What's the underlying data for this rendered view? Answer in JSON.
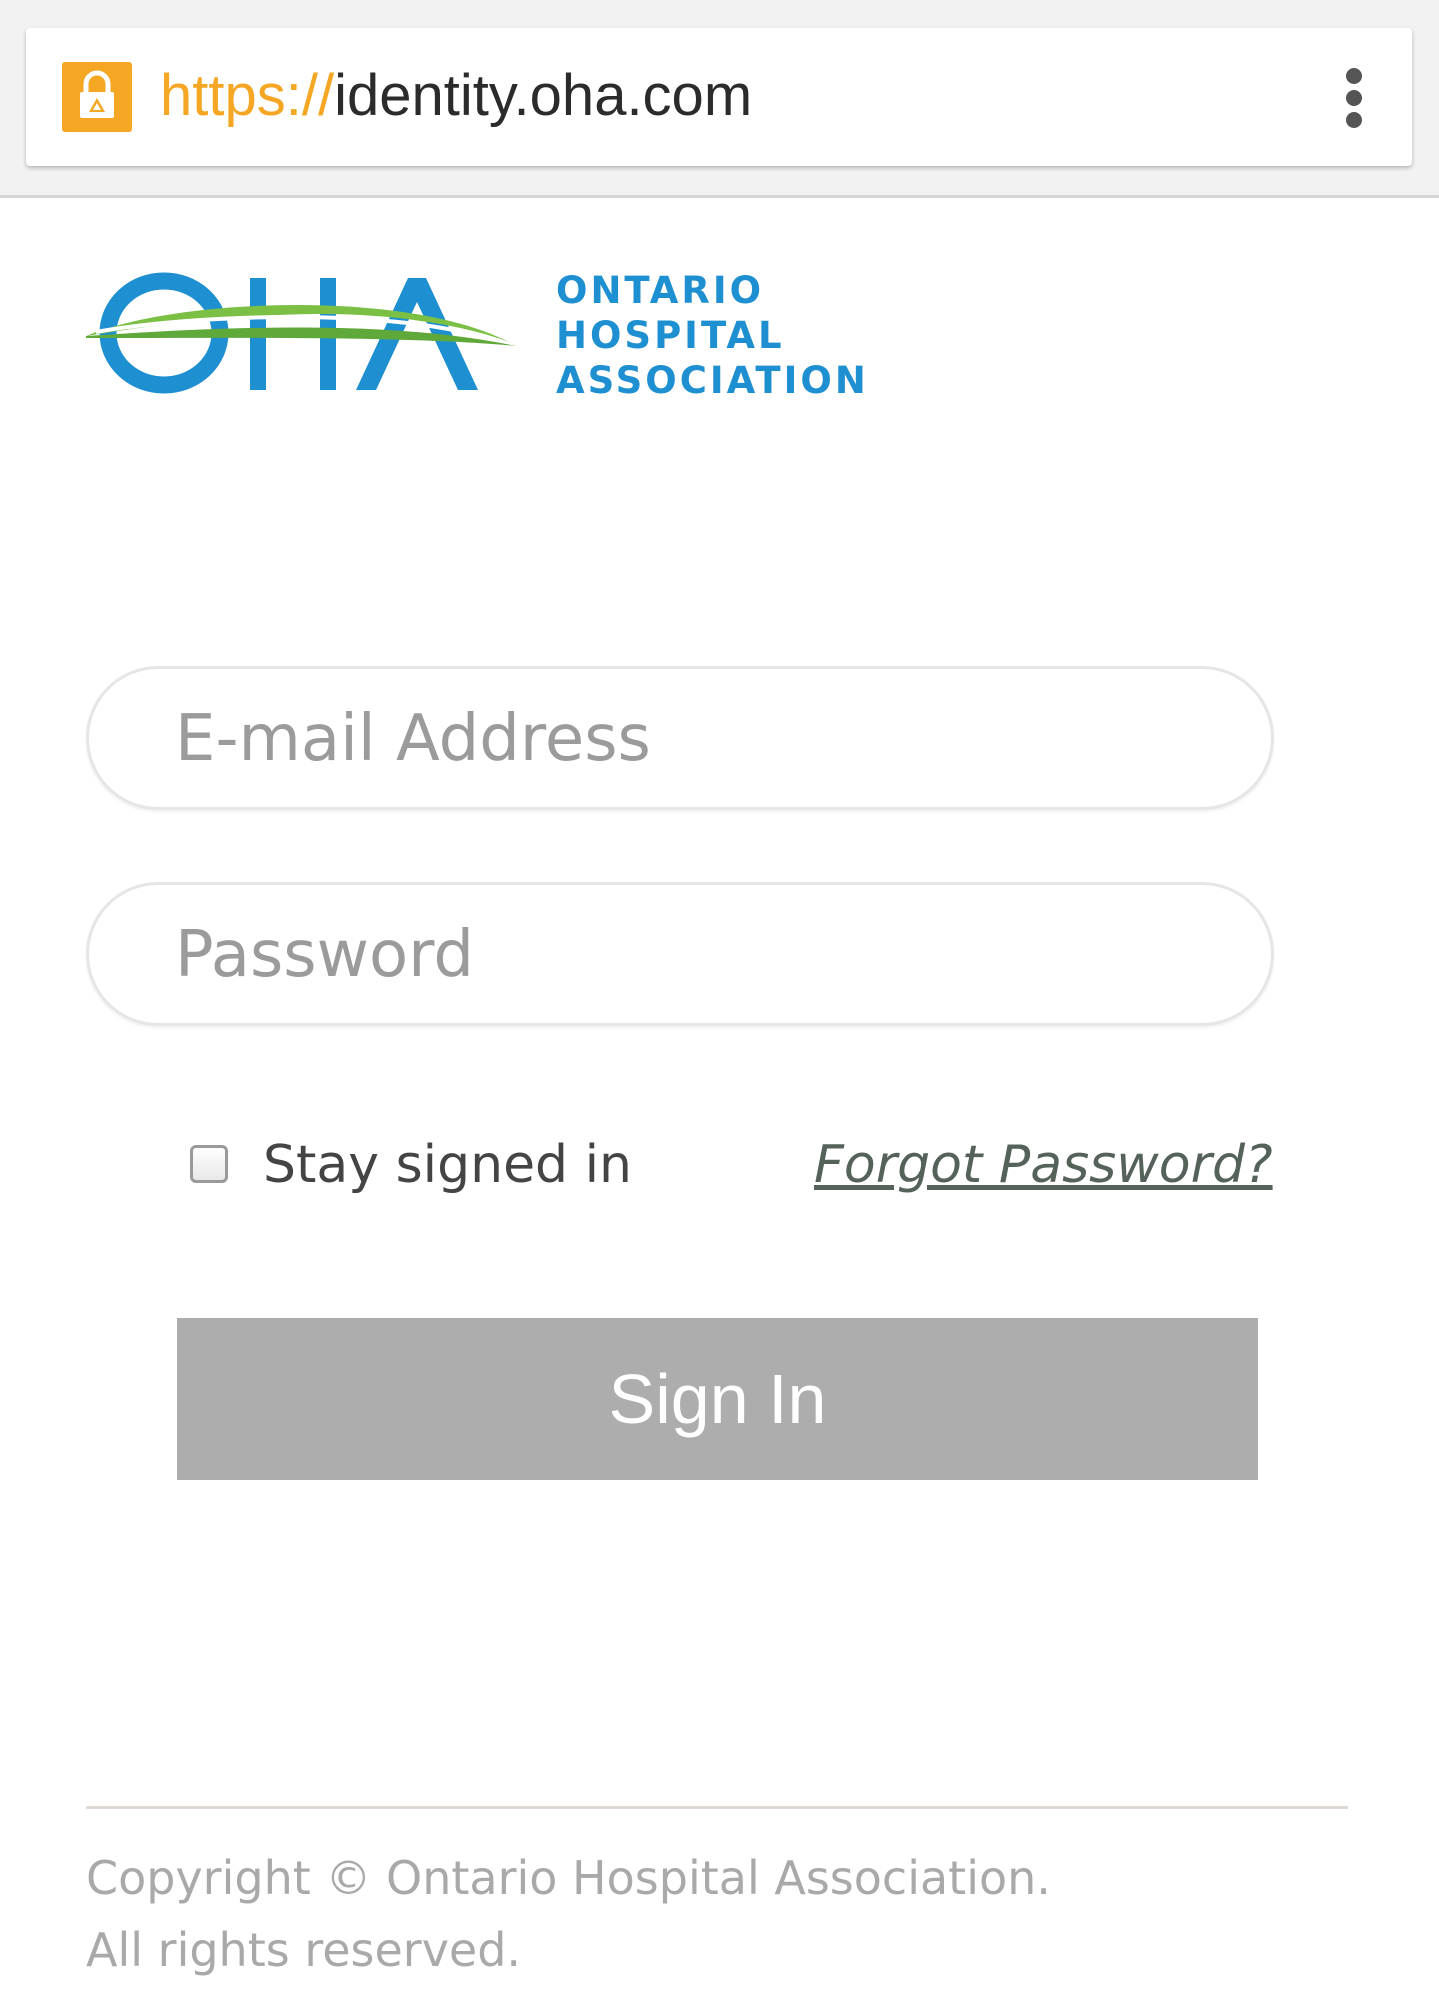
{
  "browser": {
    "url_scheme": "https://",
    "url_host": "identity.oha.com",
    "lock_icon": "lock-icon",
    "menu_icon": "more-vert-icon"
  },
  "logo": {
    "mark": "OHA",
    "lines": [
      "ONTARIO",
      "HOSPITAL",
      "ASSOCIATION"
    ]
  },
  "form": {
    "email_placeholder": "E-mail Address",
    "email_value": "",
    "password_placeholder": "Password",
    "password_value": "",
    "stay_signed_in_label": "Stay signed in",
    "stay_signed_in_checked": false,
    "forgot_password_label": "Forgot Password?",
    "sign_in_label": "Sign In"
  },
  "footer": {
    "line1": "Copyright © Ontario Hospital Association.",
    "line2": "All rights reserved."
  },
  "colors": {
    "https_accent": "#f5a623",
    "logo_blue": "#1e8fd0",
    "logo_green": "#7bbf44",
    "button_gray": "#adadad"
  }
}
